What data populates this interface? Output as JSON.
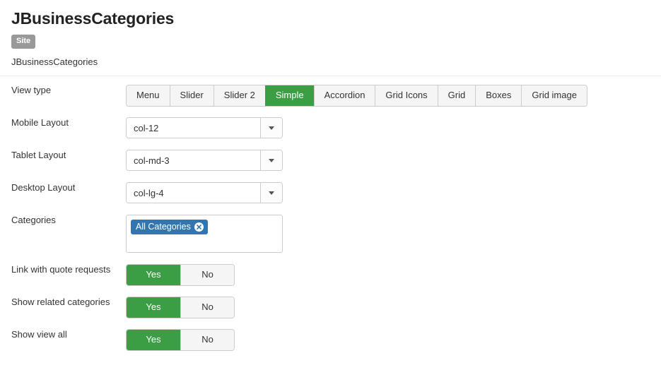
{
  "header": {
    "title": "JBusinessCategories",
    "badge": "Site",
    "breadcrumb": "JBusinessCategories"
  },
  "colors": {
    "accent_green": "#3c9e44",
    "chip_blue": "#3276b1",
    "badge_gray": "#999999",
    "border_gray": "#cccccc"
  },
  "form": {
    "view_type": {
      "label": "View type",
      "selected": "Simple",
      "options": [
        {
          "label": "Menu"
        },
        {
          "label": "Slider"
        },
        {
          "label": "Slider 2"
        },
        {
          "label": "Simple"
        },
        {
          "label": "Accordion"
        },
        {
          "label": "Grid Icons"
        },
        {
          "label": "Grid"
        },
        {
          "label": "Boxes"
        },
        {
          "label": "Grid image"
        }
      ]
    },
    "mobile_layout": {
      "label": "Mobile Layout",
      "value": "col-12"
    },
    "tablet_layout": {
      "label": "Tablet Layout",
      "value": "col-md-3"
    },
    "desktop_layout": {
      "label": "Desktop Layout",
      "value": "col-lg-4"
    },
    "categories": {
      "label": "Categories",
      "chips": [
        {
          "label": "All Categories",
          "remove_icon": "close-circle-icon"
        }
      ]
    },
    "toggles": [
      {
        "label": "Link with quote requests",
        "yes_label": "Yes",
        "no_label": "No",
        "value": "Yes"
      },
      {
        "label": "Show related categories",
        "yes_label": "Yes",
        "no_label": "No",
        "value": "Yes"
      },
      {
        "label": "Show view all",
        "yes_label": "Yes",
        "no_label": "No",
        "value": "Yes"
      }
    ]
  }
}
